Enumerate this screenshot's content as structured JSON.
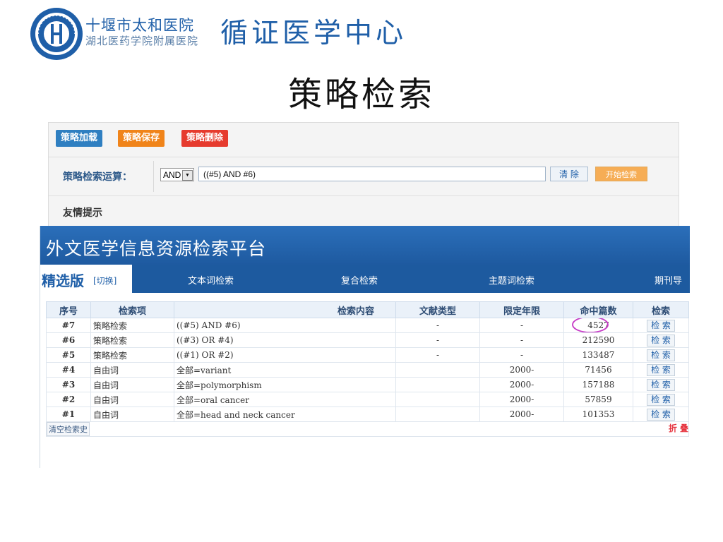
{
  "header": {
    "hospital_name": "十堰市太和医院",
    "hospital_sub": "湖北医药学院附属医院",
    "center_name": "循证医学中心"
  },
  "slide_title": "策略检索",
  "strategy_panel": {
    "buttons": {
      "load": "策略加载",
      "save": "策略保存",
      "delete": "策略删除"
    },
    "operation_label": "策略检索运算：",
    "operator_selected": "AND",
    "query": "((#5) AND #6)",
    "clear_label": "清 除",
    "start_label": "开始检索",
    "tip_label": "友情提示"
  },
  "platform": {
    "title": "外文医学信息资源检索平台",
    "version_label": "精选版",
    "version_switch": "[切换]",
    "tabs": [
      "文本词检索",
      "复合检索",
      "主题词检索",
      "期刊导"
    ]
  },
  "history_table": {
    "headers": [
      "序号",
      "检索项",
      "检索内容",
      "文献类型",
      "限定年限",
      "命中篇数",
      "检索"
    ],
    "rows": [
      {
        "seq": "#7",
        "item": "策略检索",
        "content": "((#5) AND #6)",
        "type": "-",
        "limit": "-",
        "hits": "4527",
        "action": "检 索"
      },
      {
        "seq": "#6",
        "item": "策略检索",
        "content": "((#3) OR #4)",
        "type": "-",
        "limit": "-",
        "hits": "212590",
        "action": "检 索"
      },
      {
        "seq": "#5",
        "item": "策略检索",
        "content": "((#1) OR #2)",
        "type": "-",
        "limit": "-",
        "hits": "133487",
        "action": "检 索"
      },
      {
        "seq": "#4",
        "item": "自由词",
        "content": "全部=variant",
        "type": "",
        "limit": "2000-",
        "hits": "71456",
        "action": "检 索"
      },
      {
        "seq": "#3",
        "item": "自由词",
        "content": "全部=polymorphism",
        "type": "",
        "limit": "2000-",
        "hits": "157188",
        "action": "检 索"
      },
      {
        "seq": "#2",
        "item": "自由词",
        "content": "全部=oral cancer",
        "type": "",
        "limit": "2000-",
        "hits": "57859",
        "action": "检 索"
      },
      {
        "seq": "#1",
        "item": "自由词",
        "content": "全部=head and neck cancer",
        "type": "",
        "limit": "2000-",
        "hits": "101353",
        "action": "检 索"
      }
    ],
    "clear_history": "清空检索史",
    "fold": "折 叠",
    "highlighted_hits": "4527"
  },
  "colors": {
    "brand_blue": "#1f5fa8",
    "banner_blue": "#2b6fba",
    "load_button": "#2f7fc1",
    "save_button": "#f0841a",
    "delete_button": "#e63b2e",
    "highlight_circle": "#c63bc6",
    "fold_red": "#e6343f"
  },
  "icons": {
    "logo": "hospital-emblem",
    "dropdown": "dropdown-arrow-icon"
  }
}
